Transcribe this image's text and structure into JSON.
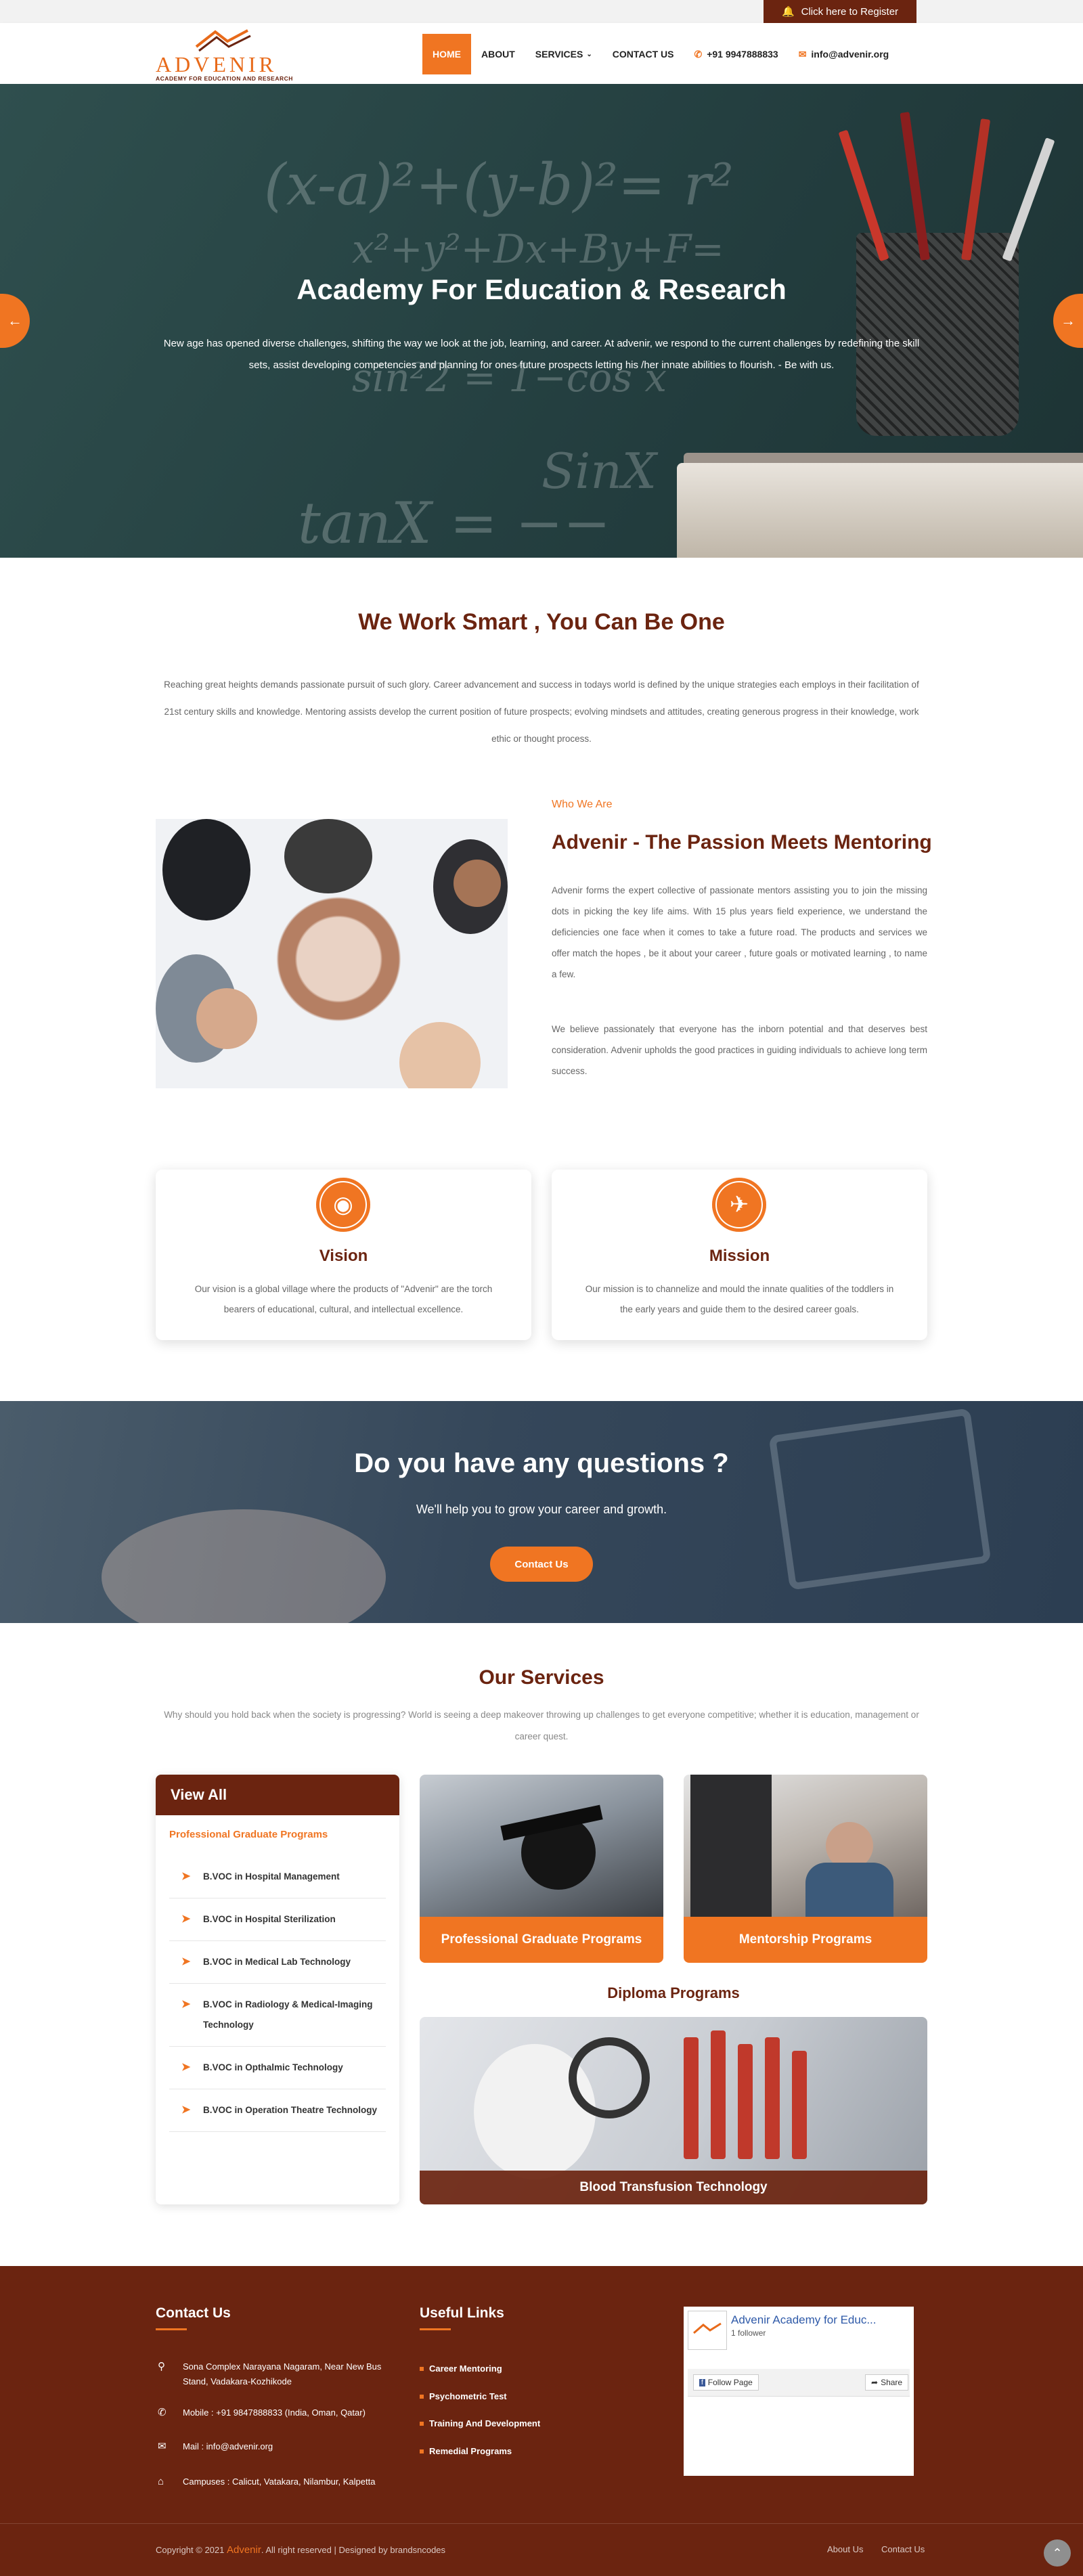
{
  "topbar": {
    "register_label": "Click here to Register",
    "register_icon": "bell-icon"
  },
  "brand": {
    "logo_word": "ADVENIR",
    "logo_tagline": "ACADEMY FOR EDUCATION AND RESEARCH"
  },
  "nav": {
    "home": "HOME",
    "about": "ABOUT",
    "services": "SERVICES",
    "contact": "CONTACT US",
    "phone": "+91 9947888833",
    "email": "info@advenir.org"
  },
  "hero": {
    "title": "Academy For Education & Research",
    "subtitle": "New age has opened diverse challenges, shifting the way we look at the job, learning, and career. At advenir, we respond to the current challenges by redefining the skill sets, assist developing competencies and planning for ones future prospects letting his /her innate abilities to flourish. - Be with us."
  },
  "intro": {
    "title": "We Work Smart , You Can Be One",
    "text": "Reaching great heights demands passionate pursuit of such glory. Career advancement and success in todays world is defined by the unique strategies each employs in their facilitation of 21st century skills and knowledge. Mentoring assists develop the current position of future prospects; evolving mindsets and attitudes, creating generous progress in their knowledge, work ethic or thought process."
  },
  "about": {
    "label": "Who We Are",
    "title": "Advenir - The Passion Meets Mentoring",
    "para1": "Advenir forms the expert collective of passionate mentors assisting you to join the missing dots in picking the key life aims. With 15 plus years field experience, we understand the deficiencies one face when it comes to take a future road. The products and services we offer match the hopes , be it about your career , future goals or motivated learning , to name a few.",
    "para2": "We believe passionately that everyone has the inborn potential and that deserves best consideration. Advenir upholds the good practices in guiding individuals to achieve long term success."
  },
  "vision": {
    "title": "Vision",
    "text": "Our vision is a global village where the products of \"Advenir\" are the torch bearers of educational, cultural, and intellectual excellence."
  },
  "mission": {
    "title": "Mission",
    "text": "Our mission is to channelize and mould the innate qualities of the toddlers in the early years and guide them to the desired career goals."
  },
  "cta": {
    "title": "Do you have any questions ?",
    "subtitle": "We'll help you to grow your career and growth.",
    "button": "Contact Us"
  },
  "services": {
    "title": "Our Services",
    "subtitle": "Why should you hold back when the society is progressing? World is seeing a deep makeover throwing up challenges to get everyone competitive; whether it is education, management or career quest.",
    "view_all": {
      "title": "View All",
      "category": "Professional Graduate Programs",
      "items": [
        "B.VOC in Hospital Management",
        "B.VOC in Hospital Sterilization",
        "B.VOC in Medical Lab Technology",
        "B.VOC in Radiology & Medical-Imaging Technology",
        "B.VOC in Opthalmic Technology",
        "B.VOC in Operation Theatre Technology"
      ]
    },
    "cards": {
      "professional": "Professional Graduate Programs",
      "mentorship": "Mentorship Programs"
    },
    "diploma_title": "Diploma Programs",
    "diploma_card": "Blood Transfusion Technology"
  },
  "footer": {
    "contact_title": "Contact Us",
    "address": "Sona Complex Narayana Nagaram, Near New Bus Stand, Vadakara-Kozhikode",
    "mobile": "Mobile : +91 9847888833 (India, Oman, Qatar)",
    "mail": "Mail : info@advenir.org",
    "campuses": "Campuses : Calicut, Vatakara, Nilambur, Kalpetta",
    "links_title": "Useful Links",
    "links": [
      "Career Mentoring",
      "Psychometric Test",
      "Training And Development",
      "Remedial Programs"
    ],
    "fb": {
      "page_name": "Advenir Academy for Educ...",
      "followers": "1 follower",
      "follow": "Follow Page",
      "share": "Share"
    },
    "copyright_prefix": "Copyright © 2021",
    "copyright_brand": "Advenir",
    "copyright_suffix": ". All right reserved | Designed by brandsncodes",
    "bottom_links": [
      "About Us",
      "Contact Us"
    ]
  },
  "colors": {
    "brand_brown": "#6b2410",
    "accent_orange": "#f07522"
  }
}
